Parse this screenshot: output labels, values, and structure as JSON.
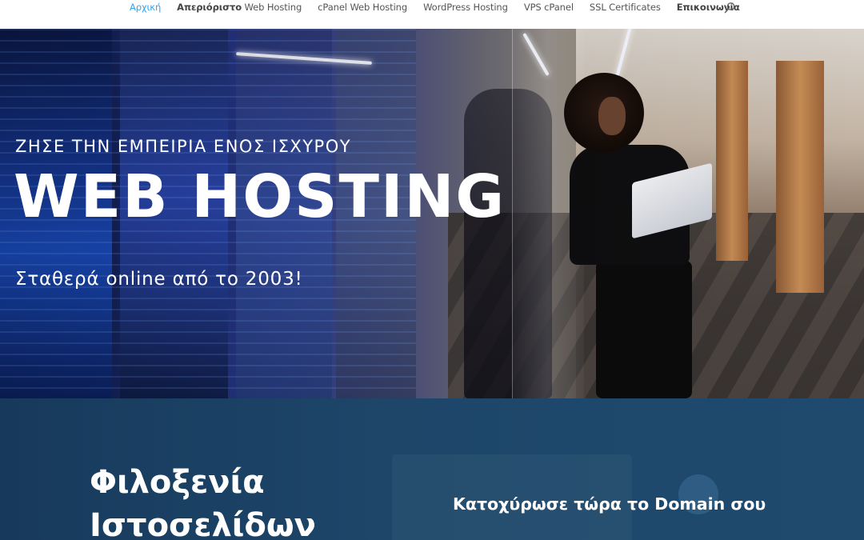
{
  "nav": {
    "items": [
      {
        "label": "Αρχική",
        "active": true
      },
      {
        "label_strong": "Απεριόριστο",
        "label": " Web Hosting"
      },
      {
        "label": "cPanel Web Hosting"
      },
      {
        "label": "WordPress Hosting"
      },
      {
        "label": "VPS cPanel"
      },
      {
        "label": "SSL Certificates"
      },
      {
        "label_strong": "Επικοινωνία",
        "label": ""
      }
    ],
    "search_icon": "search-icon"
  },
  "hero": {
    "kicker": "ΖΗΣΕ ΤΗΝ ΕΜΠΕΙΡΙΑ ΕΝΟΣ ΙΣΧΥΡΟΥ",
    "title": "WEB HOSTING",
    "subtitle": "Σταθερά online από το 2003!"
  },
  "lower": {
    "title_line1": "Φιλοξενία",
    "title_line2": "Ιστοσελίδων",
    "cta": "Κατοχύρωσε τώρα το Domain σου"
  },
  "colors": {
    "nav_active": "#2ea3f2",
    "nav_text": "#555555",
    "lower_bg": "#1d4669"
  }
}
